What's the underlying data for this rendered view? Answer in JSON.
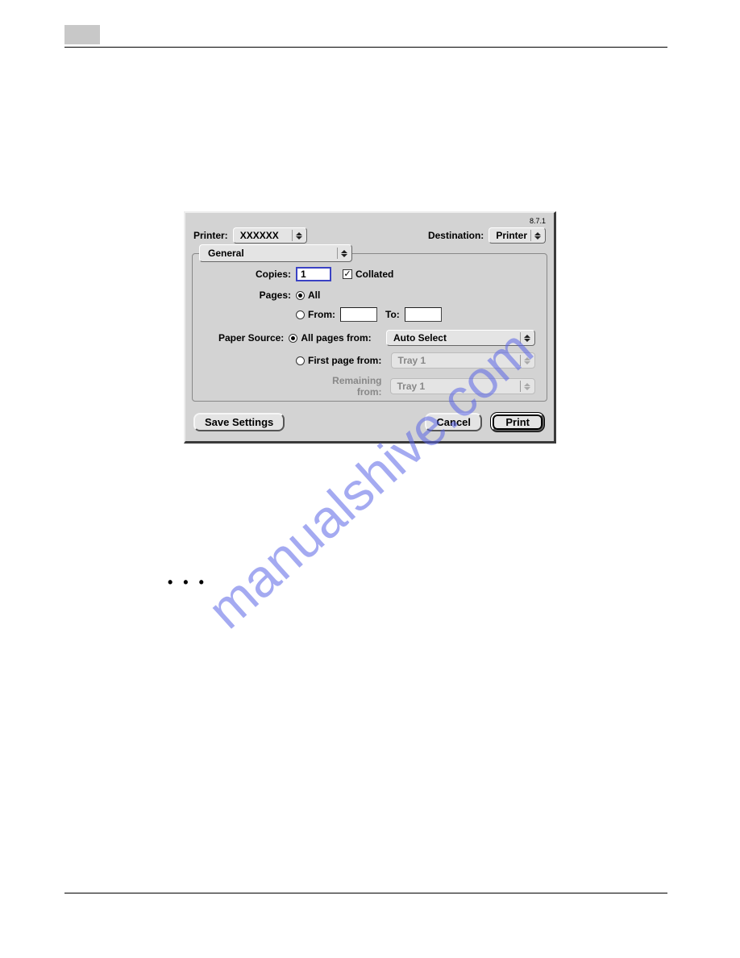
{
  "dialog": {
    "version": "8.7.1",
    "printer_label": "Printer:",
    "printer_value": "XXXXXX",
    "destination_label": "Destination:",
    "destination_value": "Printer",
    "panel": "General",
    "copies_label": "Copies:",
    "copies_value": "1",
    "collated_label": "Collated",
    "pages_label": "Pages:",
    "pages_all_label": "All",
    "pages_from_label": "From:",
    "pages_to_label": "To:",
    "pages_from_value": "",
    "pages_to_value": "",
    "paper_source_label": "Paper Source:",
    "all_pages_from_label": "All pages from:",
    "all_pages_from_value": "Auto Select",
    "first_page_from_label": "First page from:",
    "first_page_from_value": "Tray 1",
    "remaining_from_label": "Remaining from:",
    "remaining_from_value": "Tray 1",
    "save_settings_label": "Save Settings",
    "cancel_label": "Cancel",
    "print_label": "Print"
  },
  "watermark": "manualshive.com",
  "dots": "• • •"
}
